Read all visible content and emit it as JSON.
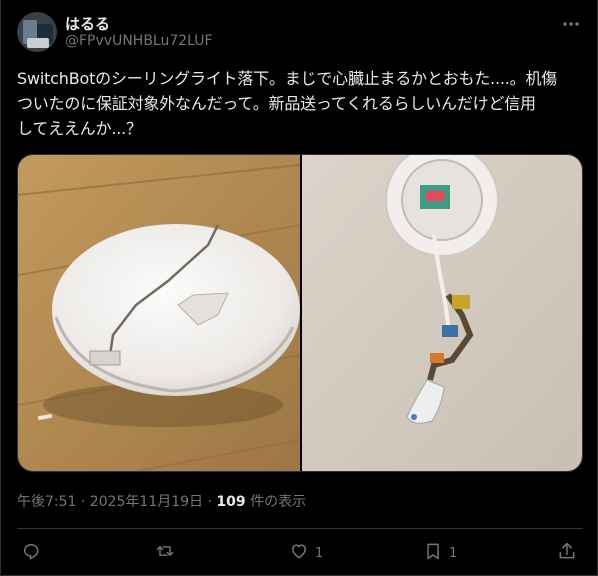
{
  "author": {
    "display_name": "はるる",
    "handle": "@FPvvUNHBLu72LUF"
  },
  "tweet": {
    "text_line1": "SwitchBotのシーリングライト落下。まじで心臓止まるかとおもた....。机傷",
    "text_line2": "ついたのに保証対象外なんだって。新品送ってくれるらしいんだけど信用",
    "text_line3": "してええんか...？"
  },
  "meta": {
    "timestamp": "午後7:51 · 2025年11月19日",
    "separator": " · ",
    "views_count": "109",
    "views_label": " 件の表示"
  },
  "actions": {
    "reply_count": "",
    "retweet_count": "",
    "like_count": "1",
    "bookmark_count": "1"
  },
  "icons": {
    "more": "more-icon",
    "reply": "reply-icon",
    "retweet": "retweet-icon",
    "like": "heart-icon",
    "bookmark": "bookmark-icon",
    "share": "share-icon"
  },
  "colors": {
    "background": "#000000",
    "text": "#e7e9ea",
    "secondary": "#71767b",
    "border": "#2f3336"
  }
}
